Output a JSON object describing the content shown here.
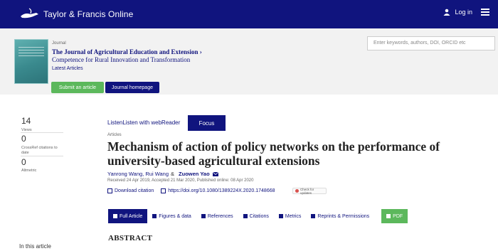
{
  "header": {
    "brand": "Taylor & Francis Online",
    "login_label": "Log in",
    "bg_color": "#10147e"
  },
  "journal": {
    "label": "Journal",
    "title": "The Journal of Agricultural Education and Extension ›",
    "subtitle": "Competence for Rural Innovation and Transformation",
    "latest": "Latest Articles",
    "submit_label": "Submit an article",
    "homepage_label": "Journal homepage"
  },
  "search": {
    "placeholder": "Enter keywords, authors, DOI, ORCID etc"
  },
  "metrics": [
    {
      "value": "14",
      "label": "Views"
    },
    {
      "value": "0",
      "label": "CrossRef citations to date"
    },
    {
      "value": "0",
      "label": "Altmetric"
    }
  ],
  "article": {
    "listen_label": "ListenListen with webReader",
    "focus_label": "Focus",
    "type": "Articles",
    "title": "Mechanism of action of policy networks on the performance of university-based agricultural extensions",
    "authors": [
      "Yanrong Wang",
      "Rui Wang"
    ],
    "amp": "&",
    "corresponding_author": "Zuowen Yao",
    "dates": "Received 24 Apr 2019, Accepted 21 Mar 2020, Published online: 08 Apr 2020",
    "download_label": "Download citation",
    "doi": "https://doi.org/10.1080/1389224X.2020.1748668",
    "check_updates": "Check for updates"
  },
  "tabs": [
    {
      "label": "Full Article",
      "icon": "document-icon"
    },
    {
      "label": "Figures & data",
      "icon": "image-icon"
    },
    {
      "label": "References",
      "icon": "references-icon"
    },
    {
      "label": "Citations",
      "icon": "quote-icon"
    },
    {
      "label": "Metrics",
      "icon": "bar-chart-icon"
    },
    {
      "label": "Reprints & Permissions",
      "icon": "cart-icon"
    },
    {
      "label": "PDF",
      "icon": "pdf-icon"
    }
  ],
  "abstract_heading": "ABSTRACT",
  "in_this_article": "In this article"
}
